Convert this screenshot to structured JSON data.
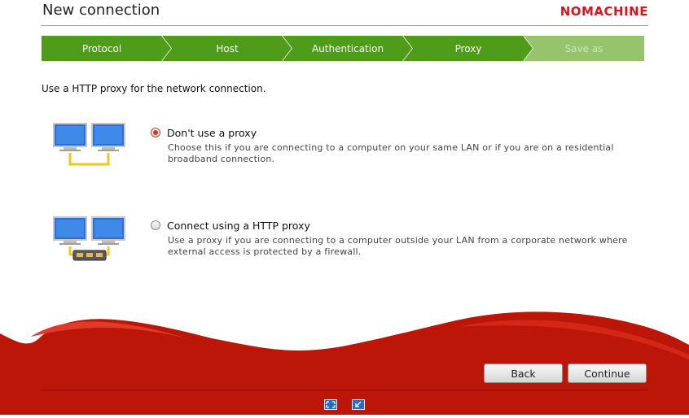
{
  "window": {
    "title": "New connection",
    "brand": "NOMACHINE"
  },
  "steps": [
    {
      "label": "Protocol",
      "state": "done"
    },
    {
      "label": "Host",
      "state": "done"
    },
    {
      "label": "Authentication",
      "state": "done"
    },
    {
      "label": "Proxy",
      "state": "current"
    },
    {
      "label": "Save as",
      "state": "future"
    }
  ],
  "intro": "Use a HTTP proxy for the network connection.",
  "options": [
    {
      "label": "Don't use a proxy",
      "selected": true,
      "desc_line1": "Choose this if you are connecting to a computer on your same LAN or if you are on a residential",
      "desc_line2": "broadband connection.",
      "icon": "lan-computers-icon"
    },
    {
      "label": "Connect using a HTTP proxy",
      "selected": false,
      "desc_line1": "Use a proxy if you are connecting to a computer outside your LAN from a corporate network where",
      "desc_line2": "external access is protected by a firewall.",
      "icon": "proxy-computers-icon"
    }
  ],
  "buttons": {
    "back": "Back",
    "continue": "Continue"
  },
  "footer_icons": [
    "fullscreen-icon",
    "minimize-window-icon"
  ],
  "colors": {
    "brand_red": "#d6141b",
    "footer_red": "#bb1608",
    "step_green": "#4e9c1a",
    "step_future": "#96c46c"
  }
}
